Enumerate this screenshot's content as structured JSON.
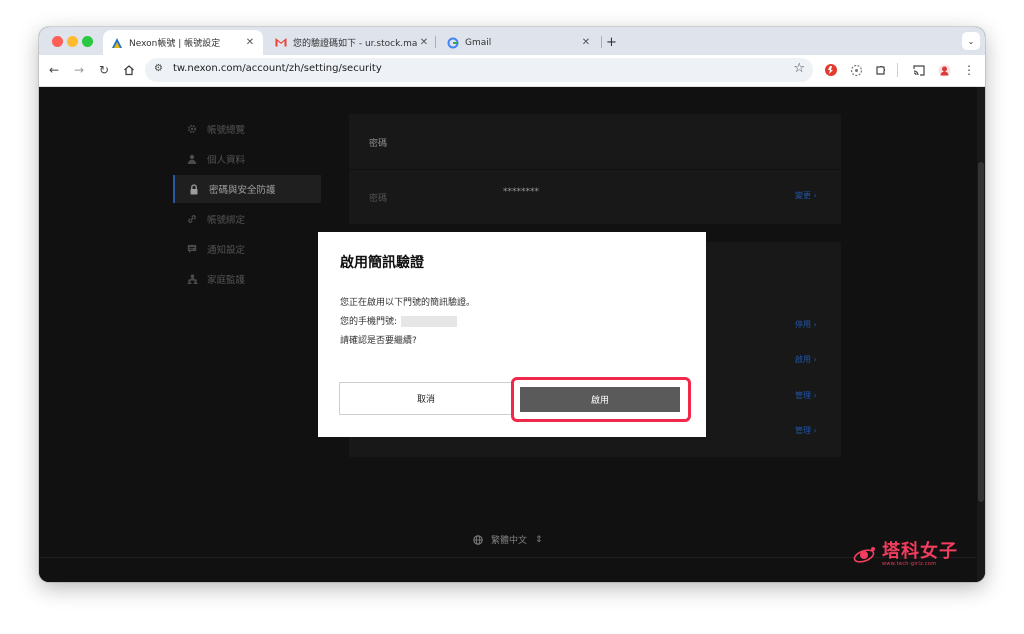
{
  "browser": {
    "tabs": [
      {
        "title": "Nexon帳號 | 帳號設定",
        "active": true,
        "favicon": "nexon-logo-icon"
      },
      {
        "title": "您的驗證碼如下 - ur.stock.man",
        "active": false,
        "favicon": "gmail-icon"
      },
      {
        "title": "Gmail",
        "active": false,
        "favicon": "google-icon"
      }
    ],
    "new_tab": "+",
    "address": "tw.nexon.com/account/zh/setting/security"
  },
  "sidebar": {
    "items": [
      {
        "label": "帳號總覽",
        "icon": "gear-icon"
      },
      {
        "label": "個人資料",
        "icon": "person-icon"
      },
      {
        "label": "密碼與安全防護",
        "icon": "lock-icon",
        "active": true
      },
      {
        "label": "帳號綁定",
        "icon": "link-icon"
      },
      {
        "label": "通知設定",
        "icon": "chat-icon"
      },
      {
        "label": "家庭監護",
        "icon": "family-icon"
      }
    ]
  },
  "password_card": {
    "header": "密碼",
    "row_label": "密碼",
    "value": "********",
    "action": "變更 ›"
  },
  "security_card": {
    "actions": [
      "停用 ›",
      "啟用 ›",
      "管理 ›",
      "管理 ›"
    ]
  },
  "modal": {
    "title": "啟用簡訊驗證",
    "line1": "您正在啟用以下門號的簡訊驗證。",
    "line2": "您的手機門號:",
    "line3": "請確認是否要繼續?",
    "cancel": "取消",
    "confirm": "啟用"
  },
  "footer": {
    "language": "繁體中文"
  },
  "watermark": {
    "name": "塔科女子",
    "site": "www.tech-girlz.com"
  },
  "colors": {
    "accent_link": "#2f7df6",
    "highlight": "#f0284a",
    "primary_button": "#5a5a5a"
  }
}
